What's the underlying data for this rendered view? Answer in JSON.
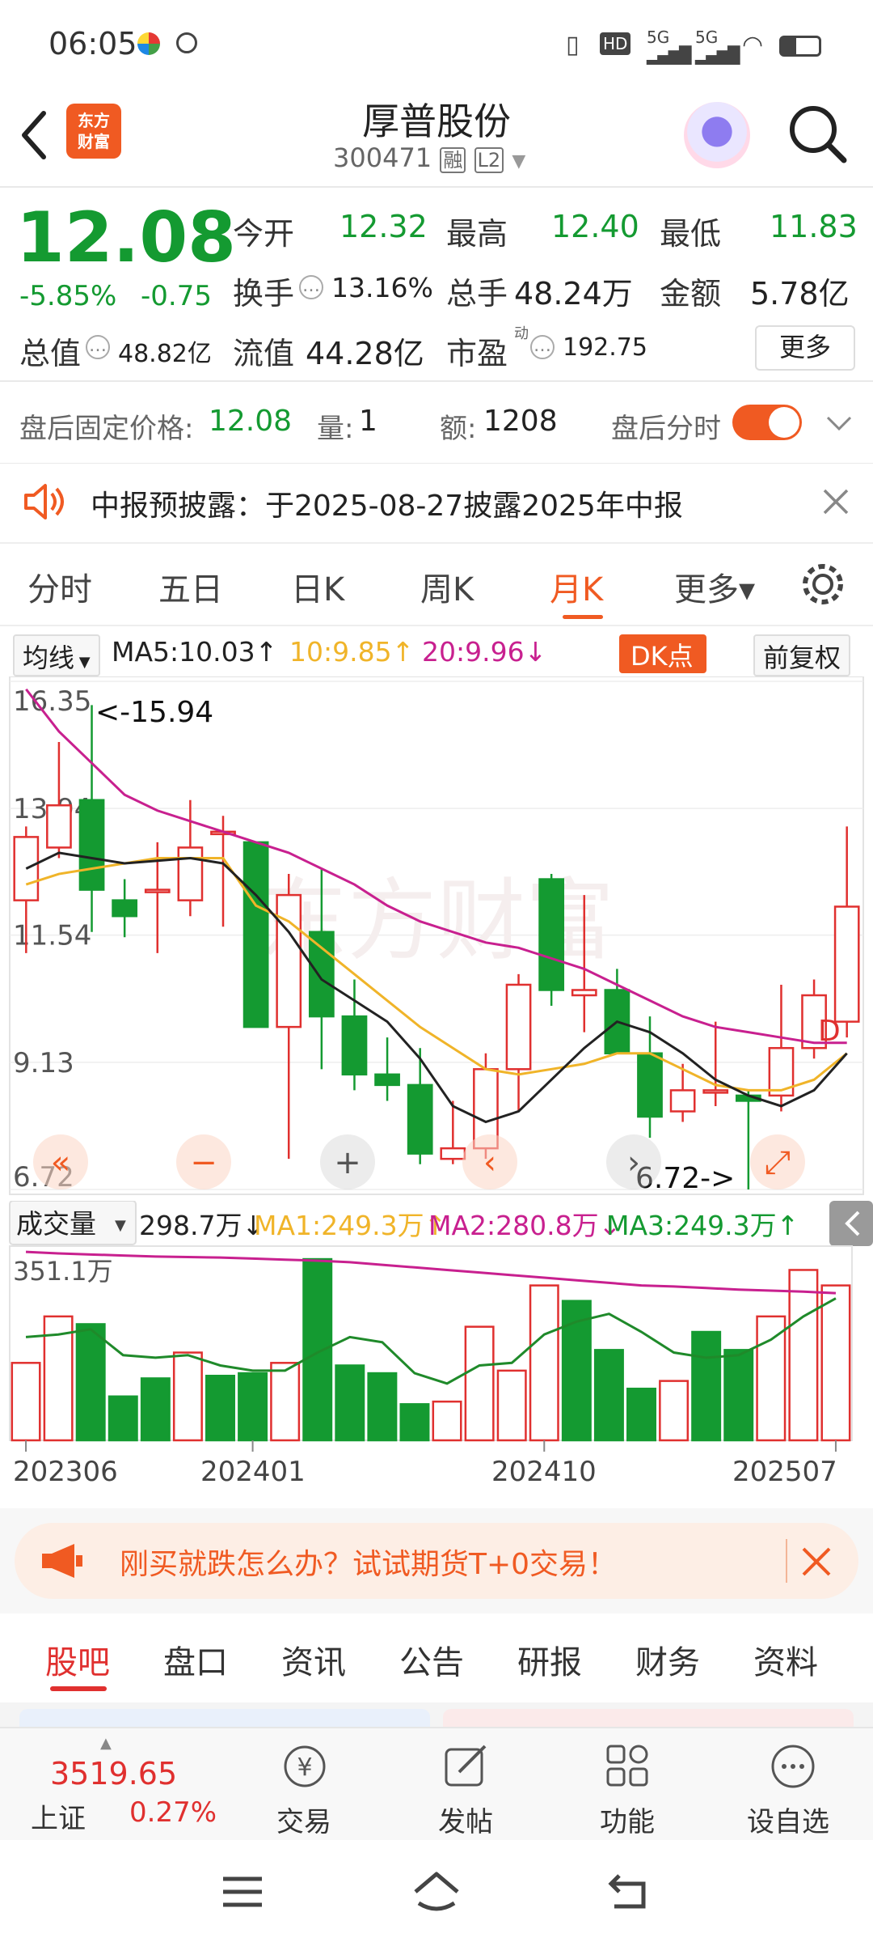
{
  "status_bar": {
    "time": "06:05",
    "network": "5G"
  },
  "header": {
    "title": "厚普股份",
    "code": "300471",
    "badge_margin": "融",
    "badge_level": "L2"
  },
  "quote": {
    "price": "12.08",
    "change_pct": "-5.85%",
    "change": "-0.75",
    "open_label": "今开",
    "open": "12.32",
    "high_label": "最高",
    "high": "12.40",
    "low_label": "最低",
    "low": "11.83",
    "turnover_label": "换手",
    "turnover": "13.16%",
    "volume_label": "总手",
    "volume": "48.24万",
    "amount_label": "金额",
    "amount": "5.78亿",
    "mktcap_label": "总值",
    "mktcap": "48.82亿",
    "float_label": "流值",
    "float": "44.28亿",
    "pe_label": "市盈",
    "pe_sup": "动",
    "pe": "192.75",
    "more_label": "更多"
  },
  "after_hours": {
    "price_label": "盘后固定价格:",
    "price": "12.08",
    "vol_label": "量:",
    "vol": "1",
    "amt_label": "额:",
    "amt": "1208",
    "timeshare_label": "盘后分时"
  },
  "notice": {
    "text": "中报预披露：于2025-08-27披露2025年中报"
  },
  "chart_tabs": [
    "分时",
    "五日",
    "日K",
    "周K",
    "月K",
    "更多▾"
  ],
  "ma_row": {
    "type_label": "均线",
    "ma5": "MA5:10.03↑",
    "ma10": "10:9.85↑",
    "ma20": "20:9.96↓",
    "dk_label": "DK点",
    "adjust_label": "前复权"
  },
  "colors": {
    "up": "#e0302f",
    "down": "#149a31",
    "ma5": "#222222",
    "ma10": "#f0b429",
    "ma20": "#c8208f",
    "accent": "#f05a22"
  },
  "chart_data": [
    {
      "type": "candlestick",
      "y_ticks": [
        "16.35",
        "13.94",
        "11.54",
        "9.13",
        "6.72"
      ],
      "ylim": [
        6.72,
        16.35
      ],
      "x_labels": [
        "202306",
        "202401",
        "202410",
        "202507"
      ],
      "annotations": [
        "<-15.94",
        "6.72->",
        "D"
      ],
      "candles": [
        {
          "o": 12.2,
          "h": 13.6,
          "l": 11.2,
          "c": 13.4
        },
        {
          "o": 13.2,
          "h": 15.2,
          "l": 13.0,
          "c": 14.0
        },
        {
          "o": 14.1,
          "h": 15.9,
          "l": 11.6,
          "c": 12.4
        },
        {
          "o": 12.2,
          "h": 12.6,
          "l": 11.5,
          "c": 11.9
        },
        {
          "o": 12.4,
          "h": 13.3,
          "l": 11.2,
          "c": 12.4
        },
        {
          "o": 12.2,
          "h": 14.1,
          "l": 11.9,
          "c": 13.2
        },
        {
          "o": 13.5,
          "h": 13.8,
          "l": 11.7,
          "c": 13.5
        },
        {
          "o": 13.3,
          "h": 13.3,
          "l": 9.8,
          "c": 9.8
        },
        {
          "o": 9.8,
          "h": 12.7,
          "l": 7.3,
          "c": 12.3
        },
        {
          "o": 11.6,
          "h": 12.8,
          "l": 9.0,
          "c": 10.0
        },
        {
          "o": 10.0,
          "h": 10.7,
          "l": 8.6,
          "c": 8.9
        },
        {
          "o": 8.9,
          "h": 9.6,
          "l": 8.4,
          "c": 8.7
        },
        {
          "o": 8.7,
          "h": 9.4,
          "l": 7.2,
          "c": 7.4
        },
        {
          "o": 7.3,
          "h": 8.4,
          "l": 7.2,
          "c": 7.5
        },
        {
          "o": 7.5,
          "h": 9.3,
          "l": 7.3,
          "c": 9.0
        },
        {
          "o": 9.0,
          "h": 10.8,
          "l": 8.2,
          "c": 10.6
        },
        {
          "o": 12.6,
          "h": 12.7,
          "l": 10.2,
          "c": 10.5
        },
        {
          "o": 10.4,
          "h": 12.3,
          "l": 9.7,
          "c": 10.5
        },
        {
          "o": 10.5,
          "h": 10.9,
          "l": 9.6,
          "c": 9.3
        },
        {
          "o": 9.3,
          "h": 10.0,
          "l": 7.7,
          "c": 8.1
        },
        {
          "o": 8.2,
          "h": 9.1,
          "l": 8.0,
          "c": 8.6
        },
        {
          "o": 8.6,
          "h": 9.9,
          "l": 8.3,
          "c": 8.6
        },
        {
          "o": 8.5,
          "h": 8.6,
          "l": 6.72,
          "c": 8.4
        },
        {
          "o": 8.5,
          "h": 10.6,
          "l": 8.2,
          "c": 9.4
        },
        {
          "o": 9.4,
          "h": 10.7,
          "l": 9.2,
          "c": 10.4
        },
        {
          "o": 9.9,
          "h": 13.6,
          "l": 9.6,
          "c": 12.08
        }
      ],
      "ma5": [
        12.8,
        13.1,
        13.0,
        12.9,
        12.95,
        13.0,
        12.9,
        12.3,
        11.6,
        10.7,
        10.3,
        9.9,
        9.2,
        8.3,
        8.0,
        8.2,
        8.8,
        9.4,
        9.9,
        9.7,
        9.3,
        8.8,
        8.5,
        8.3,
        8.6,
        9.3
      ],
      "ma10": [
        12.5,
        12.7,
        12.8,
        12.9,
        13.0,
        13.0,
        13.0,
        12.1,
        11.8,
        11.3,
        10.8,
        10.3,
        9.8,
        9.4,
        9.0,
        8.9,
        9.0,
        9.1,
        9.3,
        9.3,
        9.0,
        8.7,
        8.6,
        8.6,
        8.8,
        9.3
      ],
      "ma20": [
        16.2,
        15.4,
        14.8,
        14.2,
        13.9,
        13.7,
        13.5,
        13.3,
        13.1,
        12.8,
        12.5,
        12.1,
        11.8,
        11.6,
        11.4,
        11.3,
        11.1,
        10.9,
        10.6,
        10.3,
        10.0,
        9.8,
        9.7,
        9.6,
        9.5,
        9.5
      ]
    },
    {
      "type": "bar",
      "label": "成交量",
      "current": "298.7万↓",
      "ma1": "MA1:249.3万↑",
      "ma2": "MA2:280.8万↓",
      "ma3": "MA3:249.3万↑",
      "max_label": "351.1万",
      "values": [
        150,
        240,
        225,
        85,
        120,
        170,
        125,
        130,
        150,
        351,
        145,
        130,
        70,
        75,
        220,
        135,
        300,
        270,
        175,
        100,
        115,
        210,
        175,
        240,
        330,
        300
      ],
      "up": [
        true,
        true,
        false,
        false,
        false,
        true,
        false,
        false,
        true,
        false,
        false,
        false,
        false,
        true,
        true,
        true,
        true,
        false,
        false,
        false,
        true,
        false,
        false,
        true,
        true,
        true
      ],
      "ma_line1": [
        200,
        205,
        215,
        165,
        160,
        165,
        145,
        135,
        135,
        170,
        200,
        190,
        130,
        110,
        145,
        150,
        205,
        230,
        245,
        210,
        170,
        160,
        165,
        195,
        240,
        275
      ],
      "ma_line2": [
        365,
        362,
        360,
        358,
        356,
        355,
        354,
        352,
        350,
        348,
        345,
        340,
        335,
        330,
        325,
        320,
        315,
        310,
        305,
        300,
        298,
        295,
        292,
        290,
        288,
        285
      ]
    }
  ],
  "promo": {
    "text": "刚买就跌怎么办？试试期货T+0交易！"
  },
  "sub_tabs": [
    "股吧",
    "盘口",
    "资讯",
    "公告",
    "研报",
    "财务",
    "资料"
  ],
  "bottom_bar": {
    "index_value": "3519.65",
    "index_name": "上证",
    "index_change": "0.27%",
    "items": [
      "交易",
      "发帖",
      "功能",
      "设自选"
    ]
  }
}
